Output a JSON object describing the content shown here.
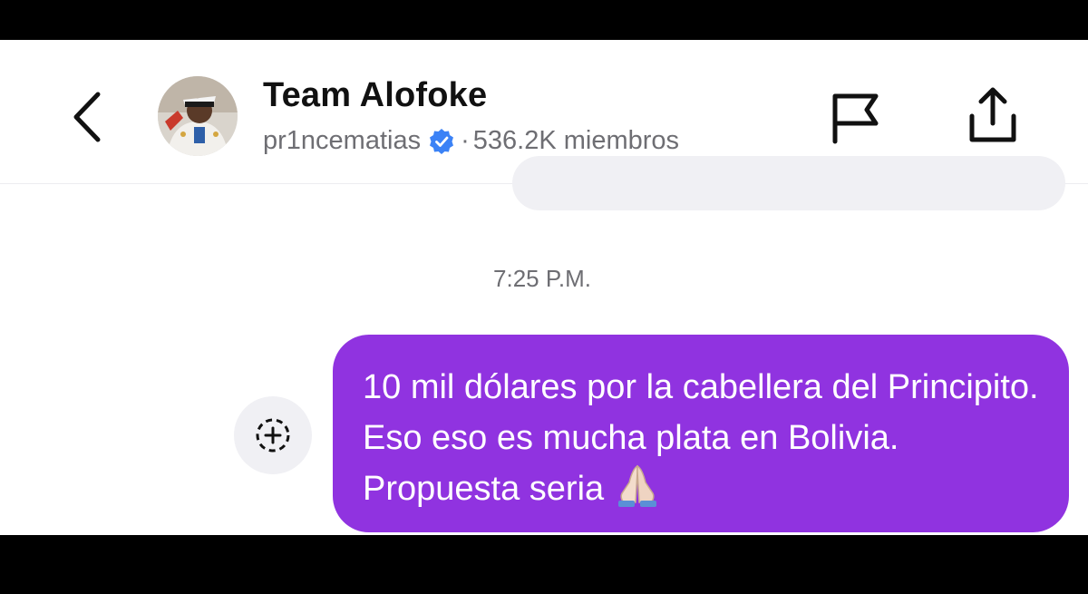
{
  "header": {
    "title": "Team Alofoke",
    "username": "pr1ncematias",
    "separator": "·",
    "members": "536.2K miembros",
    "icons": {
      "back": "chevron-left-icon",
      "avatar": "avatar",
      "verified": "verified-badge-icon",
      "flag": "flag-icon",
      "share": "share-icon"
    },
    "verified_color": "#3b82f6"
  },
  "chat": {
    "timestamp": "7:25 P.M.",
    "message": "10 mil dólares por la cabellera del Principito. Eso eso es mucha plata en Bolivia. Propuesta seria",
    "message_emoji": "folded-hands-emoji",
    "bubble_color": "#9033e0",
    "reaction_button_icon": "add-reaction-icon"
  }
}
